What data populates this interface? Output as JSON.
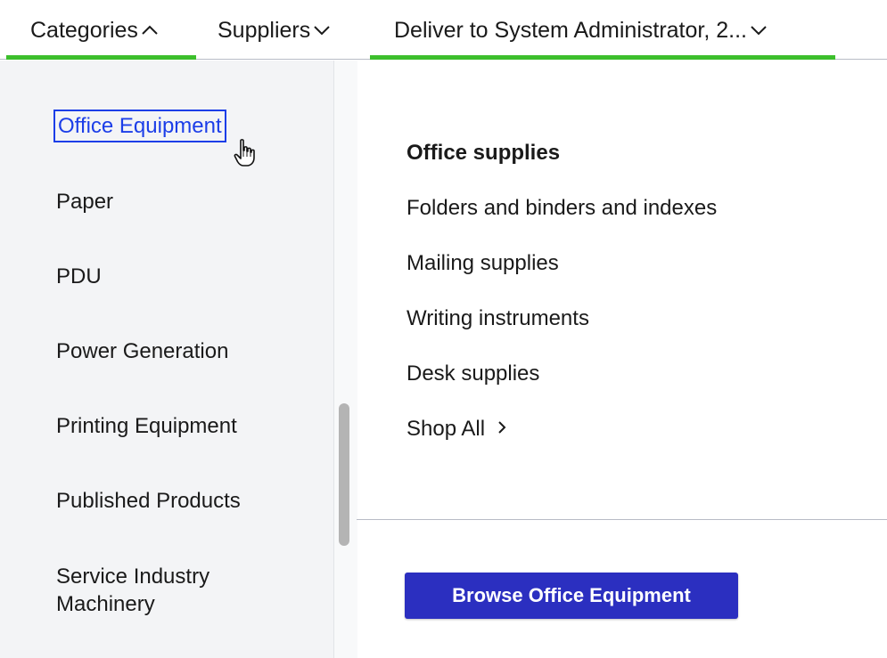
{
  "nav": {
    "categories_label": "Categories",
    "suppliers_label": "Suppliers",
    "deliver_label": "Deliver to System Administrator, 2...",
    "accent_color": "#3cbf2c"
  },
  "categories": {
    "items": [
      "Office Equipment",
      "Paper",
      "PDU",
      "Power Generation",
      "Printing Equipment",
      "Published Products",
      "Service Industry",
      "Machinery"
    ],
    "selected": "Office Equipment"
  },
  "subcategories": {
    "items": [
      "Office supplies",
      "Folders and binders and indexes",
      "Mailing supplies",
      "Writing instruments",
      "Desk supplies"
    ],
    "shop_all_label": "Shop All"
  },
  "browse_button": {
    "label": "Browse Office Equipment",
    "color": "#2b2fc0"
  },
  "icons": {
    "categories_chevron": "chevron-up-icon",
    "suppliers_chevron": "chevron-down-icon",
    "deliver_chevron": "chevron-down-icon",
    "shop_all_chevron": "chevron-right-icon",
    "cursor": "hand-pointer-icon"
  }
}
